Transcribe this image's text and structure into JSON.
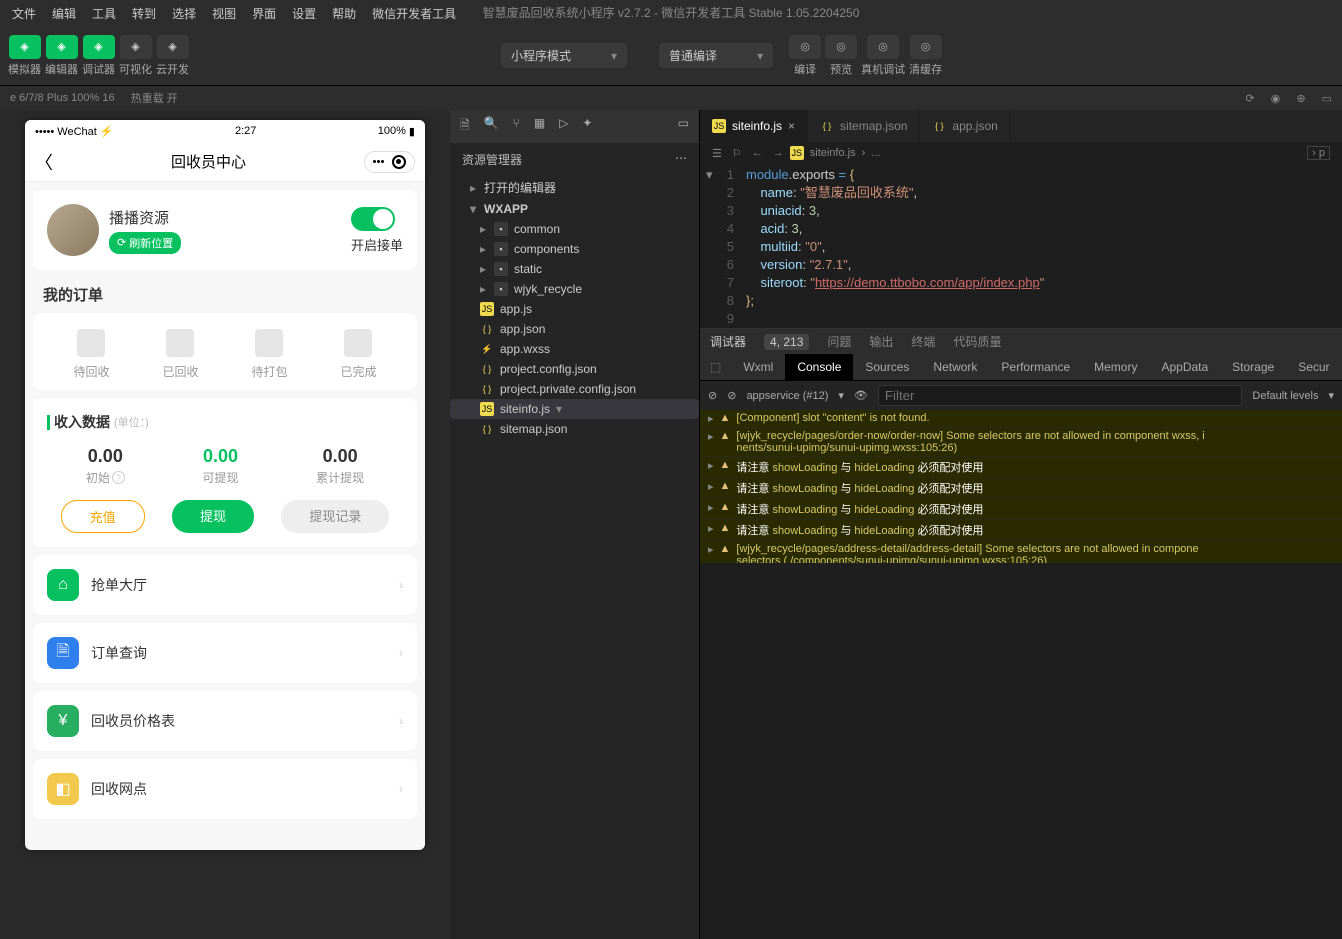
{
  "window_title": "智慧废品回收系统小程序 v2.7.2 - 微信开发者工具 Stable 1.05.2204250",
  "menu": [
    "文件",
    "编辑",
    "工具",
    "转到",
    "选择",
    "视图",
    "界面",
    "设置",
    "帮助",
    "微信开发者工具"
  ],
  "toolbar": {
    "groups": [
      {
        "label": "模拟器"
      },
      {
        "label": "编辑器"
      },
      {
        "label": "调试器"
      },
      {
        "label": "可视化"
      },
      {
        "label": "云开发"
      }
    ],
    "mode_select": "小程序模式",
    "compile_select": "普通编译",
    "actions": [
      "编译",
      "预览",
      "真机调试",
      "清缓存"
    ]
  },
  "status": {
    "device": "e 6/7/8 Plus 100% 16",
    "hot": "热重载 开",
    "right_side": "p"
  },
  "simulator": {
    "status_left": "••••• WeChat ⚡",
    "status_time": "2:27",
    "status_right": "100%",
    "nav_title": "回收员中心",
    "profile_name": "播播资源",
    "refresh": "刷新位置",
    "accept_label": "开启接单",
    "orders_title": "我的订单",
    "order_tabs": [
      "待回收",
      "已回收",
      "待打包",
      "已完成"
    ],
    "income_title": "收入数据",
    "income_unit": "(单位：)",
    "income": [
      {
        "val": "0.00",
        "lbl": "初始",
        "q": true,
        "color": "#333"
      },
      {
        "val": "0.00",
        "lbl": "可提现",
        "color": "#07c160"
      },
      {
        "val": "0.00",
        "lbl": "累计提现",
        "color": "#333"
      }
    ],
    "btns": {
      "recharge": "充值",
      "withdraw": "提现",
      "records": "提现记录"
    },
    "menu": [
      {
        "txt": "抢单大厅",
        "color": "#07c160",
        "ic": "⌂"
      },
      {
        "txt": "订单查询",
        "color": "#2f80ed",
        "ic": "🗎"
      },
      {
        "txt": "回收员价格表",
        "color": "#27ae60",
        "ic": "¥"
      },
      {
        "txt": "回收网点",
        "color": "#f2c94c",
        "ic": "◧"
      }
    ]
  },
  "explorer": {
    "title": "资源管理器",
    "sections": {
      "open": "打开的编辑器",
      "root": "WXAPP"
    },
    "tree": [
      {
        "name": "common",
        "type": "folder",
        "d": 1
      },
      {
        "name": "components",
        "type": "folder",
        "d": 1
      },
      {
        "name": "static",
        "type": "folder",
        "d": 1
      },
      {
        "name": "wjyk_recycle",
        "type": "folder",
        "d": 1
      },
      {
        "name": "app.js",
        "type": "js",
        "d": 1
      },
      {
        "name": "app.json",
        "type": "json",
        "d": 1
      },
      {
        "name": "app.wxss",
        "type": "wxss",
        "d": 1
      },
      {
        "name": "project.config.json",
        "type": "json",
        "d": 1
      },
      {
        "name": "project.private.config.json",
        "type": "json",
        "d": 1
      },
      {
        "name": "siteinfo.js",
        "type": "js",
        "d": 1,
        "sel": true
      },
      {
        "name": "sitemap.json",
        "type": "json",
        "d": 1
      }
    ]
  },
  "tabs": [
    {
      "name": "siteinfo.js",
      "type": "js",
      "active": true,
      "close": true
    },
    {
      "name": "sitemap.json",
      "type": "json"
    },
    {
      "name": "app.json",
      "type": "json"
    }
  ],
  "breadcrumb": [
    "siteinfo.js",
    "..."
  ],
  "code": {
    "lines": [
      "1",
      "2",
      "3",
      "4",
      "5",
      "6",
      "7",
      "8",
      "9"
    ],
    "l1a": "module",
    "l1b": ".exports ",
    "l1c": "=",
    "l1d": " {",
    "l2k": "name",
    "l2v": "\"智慧废品回收系统\"",
    "l3k": "uniacid",
    "l3v": "3",
    "l4k": "acid",
    "l4v": "3",
    "l5k": "multiid",
    "l5v": "\"0\"",
    "l6k": "version",
    "l6v": "\"2.7.1\"",
    "l7k": "siteroot",
    "l7v": "\"",
    "l7u": "https://demo.ttbobo.com/app/index.php",
    "l7e": "\"",
    "l8": "};"
  },
  "debugger": {
    "top": {
      "name": "调试器",
      "count": "4, 213",
      "tabs": [
        "问题",
        "输出",
        "终端",
        "代码质量"
      ]
    },
    "tabs": [
      "Wxml",
      "Console",
      "Sources",
      "Network",
      "Performance",
      "Memory",
      "AppData",
      "Storage",
      "Secur"
    ],
    "active_tab": "Console",
    "filter": {
      "ctx": "appservice (#12)",
      "placeholder": "Filter",
      "levels": "Default levels"
    },
    "logs": [
      {
        "t": "[Component] slot \"content\" is not found."
      },
      {
        "t": "[wjyk_recycle/pages/order-now/order-now] Some selectors are not allowed in component wxss, i",
        "t2": "nents/sunui-upimg/sunui-upimg.wxss:105:26)"
      },
      {
        "t": "请注意 showLoading 与 hideLoading 必须配对使用",
        "hl": true
      },
      {
        "t": "请注意 showLoading 与 hideLoading 必须配对使用",
        "hl": true
      },
      {
        "t": "请注意 showLoading 与 hideLoading 必须配对使用",
        "hl": true
      },
      {
        "t": "请注意 showLoading 与 hideLoading 必须配对使用",
        "hl": true
      },
      {
        "t": "[wjyk_recycle/pages/address-detail/address-detail] Some selectors are not allowed in compone",
        "t2": "selectors ( /components/sunui-upimg/sunui-upimg.wxss:105:26)"
      }
    ]
  }
}
